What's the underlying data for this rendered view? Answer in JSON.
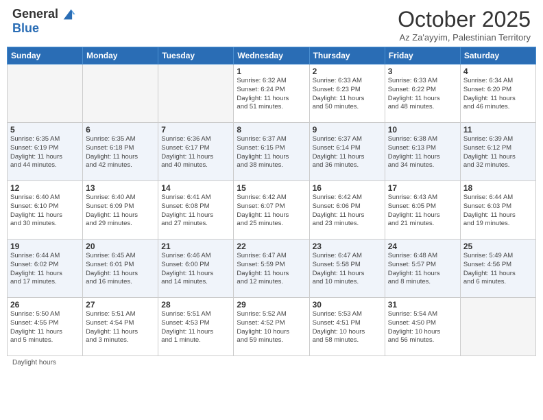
{
  "logo": {
    "general": "General",
    "blue": "Blue"
  },
  "title": "October 2025",
  "subtitle": "Az Za'ayyim, Palestinian Territory",
  "weekdays": [
    "Sunday",
    "Monday",
    "Tuesday",
    "Wednesday",
    "Thursday",
    "Friday",
    "Saturday"
  ],
  "weeks": [
    [
      {
        "day": "",
        "info": ""
      },
      {
        "day": "",
        "info": ""
      },
      {
        "day": "",
        "info": ""
      },
      {
        "day": "1",
        "info": "Sunrise: 6:32 AM\nSunset: 6:24 PM\nDaylight: 11 hours\nand 51 minutes."
      },
      {
        "day": "2",
        "info": "Sunrise: 6:33 AM\nSunset: 6:23 PM\nDaylight: 11 hours\nand 50 minutes."
      },
      {
        "day": "3",
        "info": "Sunrise: 6:33 AM\nSunset: 6:22 PM\nDaylight: 11 hours\nand 48 minutes."
      },
      {
        "day": "4",
        "info": "Sunrise: 6:34 AM\nSunset: 6:20 PM\nDaylight: 11 hours\nand 46 minutes."
      }
    ],
    [
      {
        "day": "5",
        "info": "Sunrise: 6:35 AM\nSunset: 6:19 PM\nDaylight: 11 hours\nand 44 minutes."
      },
      {
        "day": "6",
        "info": "Sunrise: 6:35 AM\nSunset: 6:18 PM\nDaylight: 11 hours\nand 42 minutes."
      },
      {
        "day": "7",
        "info": "Sunrise: 6:36 AM\nSunset: 6:17 PM\nDaylight: 11 hours\nand 40 minutes."
      },
      {
        "day": "8",
        "info": "Sunrise: 6:37 AM\nSunset: 6:15 PM\nDaylight: 11 hours\nand 38 minutes."
      },
      {
        "day": "9",
        "info": "Sunrise: 6:37 AM\nSunset: 6:14 PM\nDaylight: 11 hours\nand 36 minutes."
      },
      {
        "day": "10",
        "info": "Sunrise: 6:38 AM\nSunset: 6:13 PM\nDaylight: 11 hours\nand 34 minutes."
      },
      {
        "day": "11",
        "info": "Sunrise: 6:39 AM\nSunset: 6:12 PM\nDaylight: 11 hours\nand 32 minutes."
      }
    ],
    [
      {
        "day": "12",
        "info": "Sunrise: 6:40 AM\nSunset: 6:10 PM\nDaylight: 11 hours\nand 30 minutes."
      },
      {
        "day": "13",
        "info": "Sunrise: 6:40 AM\nSunset: 6:09 PM\nDaylight: 11 hours\nand 29 minutes."
      },
      {
        "day": "14",
        "info": "Sunrise: 6:41 AM\nSunset: 6:08 PM\nDaylight: 11 hours\nand 27 minutes."
      },
      {
        "day": "15",
        "info": "Sunrise: 6:42 AM\nSunset: 6:07 PM\nDaylight: 11 hours\nand 25 minutes."
      },
      {
        "day": "16",
        "info": "Sunrise: 6:42 AM\nSunset: 6:06 PM\nDaylight: 11 hours\nand 23 minutes."
      },
      {
        "day": "17",
        "info": "Sunrise: 6:43 AM\nSunset: 6:05 PM\nDaylight: 11 hours\nand 21 minutes."
      },
      {
        "day": "18",
        "info": "Sunrise: 6:44 AM\nSunset: 6:03 PM\nDaylight: 11 hours\nand 19 minutes."
      }
    ],
    [
      {
        "day": "19",
        "info": "Sunrise: 6:44 AM\nSunset: 6:02 PM\nDaylight: 11 hours\nand 17 minutes."
      },
      {
        "day": "20",
        "info": "Sunrise: 6:45 AM\nSunset: 6:01 PM\nDaylight: 11 hours\nand 16 minutes."
      },
      {
        "day": "21",
        "info": "Sunrise: 6:46 AM\nSunset: 6:00 PM\nDaylight: 11 hours\nand 14 minutes."
      },
      {
        "day": "22",
        "info": "Sunrise: 6:47 AM\nSunset: 5:59 PM\nDaylight: 11 hours\nand 12 minutes."
      },
      {
        "day": "23",
        "info": "Sunrise: 6:47 AM\nSunset: 5:58 PM\nDaylight: 11 hours\nand 10 minutes."
      },
      {
        "day": "24",
        "info": "Sunrise: 6:48 AM\nSunset: 5:57 PM\nDaylight: 11 hours\nand 8 minutes."
      },
      {
        "day": "25",
        "info": "Sunrise: 5:49 AM\nSunset: 4:56 PM\nDaylight: 11 hours\nand 6 minutes."
      }
    ],
    [
      {
        "day": "26",
        "info": "Sunrise: 5:50 AM\nSunset: 4:55 PM\nDaylight: 11 hours\nand 5 minutes."
      },
      {
        "day": "27",
        "info": "Sunrise: 5:51 AM\nSunset: 4:54 PM\nDaylight: 11 hours\nand 3 minutes."
      },
      {
        "day": "28",
        "info": "Sunrise: 5:51 AM\nSunset: 4:53 PM\nDaylight: 11 hours\nand 1 minute."
      },
      {
        "day": "29",
        "info": "Sunrise: 5:52 AM\nSunset: 4:52 PM\nDaylight: 10 hours\nand 59 minutes."
      },
      {
        "day": "30",
        "info": "Sunrise: 5:53 AM\nSunset: 4:51 PM\nDaylight: 10 hours\nand 58 minutes."
      },
      {
        "day": "31",
        "info": "Sunrise: 5:54 AM\nSunset: 4:50 PM\nDaylight: 10 hours\nand 56 minutes."
      },
      {
        "day": "",
        "info": ""
      }
    ]
  ],
  "footer": {
    "daylight_label": "Daylight hours"
  }
}
